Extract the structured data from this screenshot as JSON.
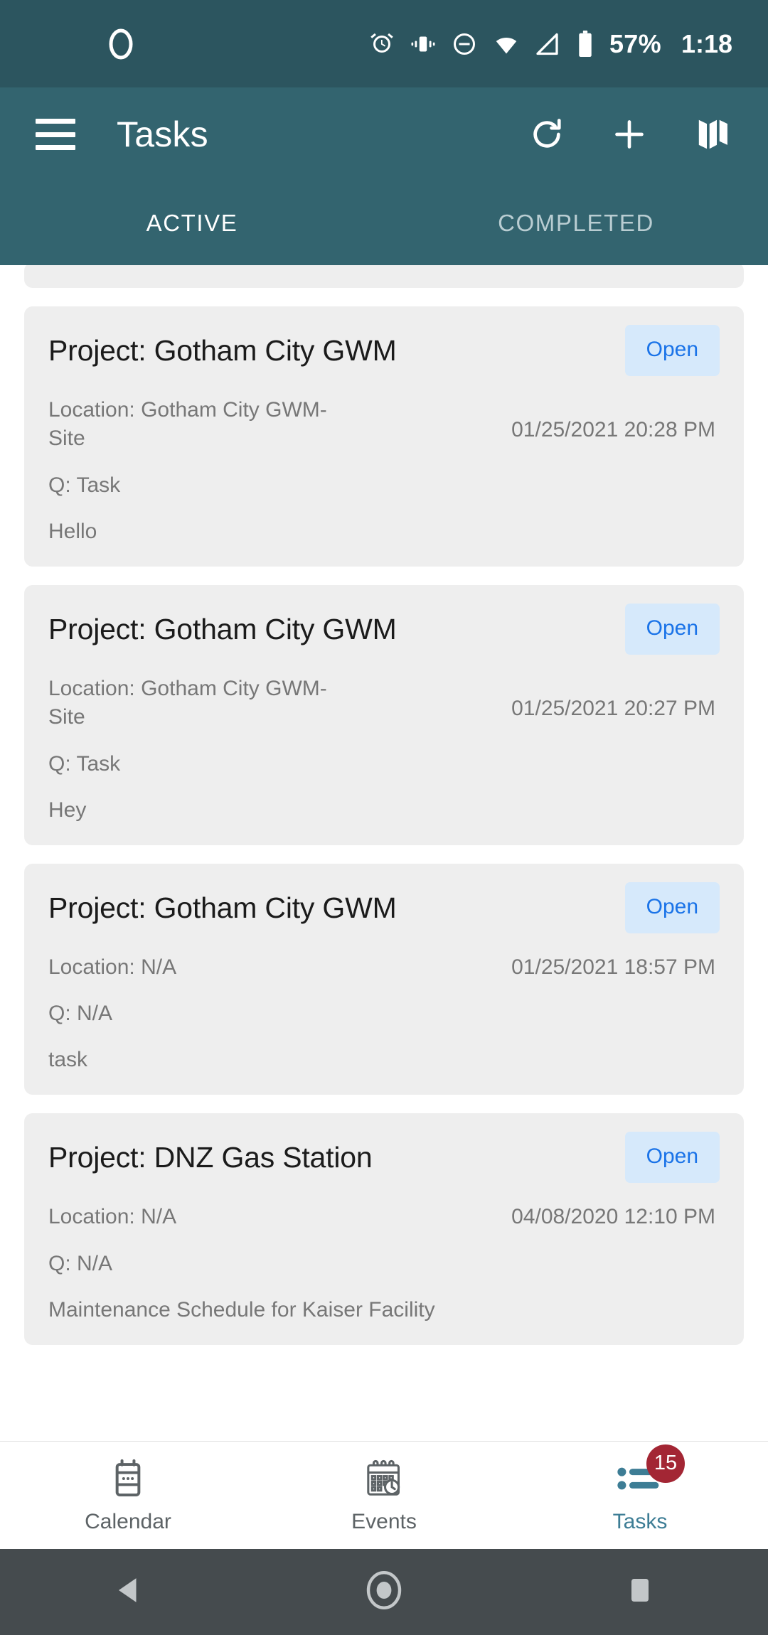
{
  "status_bar": {
    "app_indicator_icon": "app-oval-icon",
    "icons": [
      "alarm-icon",
      "vibrate-icon",
      "do-not-disturb-icon",
      "wifi-icon",
      "cell-signal-icon",
      "battery-icon"
    ],
    "battery_percent": "57%",
    "time": "1:18",
    "background_color": "#2c555f"
  },
  "appbar": {
    "menu_icon": "hamburger-menu-icon",
    "title": "Tasks",
    "actions": [
      {
        "name": "refresh-icon",
        "label": "Refresh"
      },
      {
        "name": "add-icon",
        "label": "Add"
      },
      {
        "name": "map-icon",
        "label": "Map"
      }
    ],
    "background_color": "#33646f"
  },
  "tabs": [
    {
      "label": "ACTIVE",
      "selected": true
    },
    {
      "label": "COMPLETED",
      "selected": false
    }
  ],
  "list": {
    "open_label": "Open",
    "cards": [
      {
        "title": "Project: Gotham City GWM",
        "location": "Location: Gotham City GWM-Site",
        "date": "01/25/2021 20:28 PM",
        "q": "Q: Task",
        "description": "Hello"
      },
      {
        "title": "Project: Gotham City GWM",
        "location": "Location: Gotham City GWM-Site",
        "date": "01/25/2021 20:27 PM",
        "q": "Q: Task",
        "description": "Hey"
      },
      {
        "title": "Project: Gotham City GWM",
        "location": "Location: N/A",
        "date": "01/25/2021 18:57 PM",
        "q": "Q: N/A",
        "description": "task"
      },
      {
        "title": "Project: DNZ Gas Station",
        "location": "Location: N/A",
        "date": "04/08/2020 12:10 PM",
        "q": "Q: N/A",
        "description": "Maintenance Schedule for Kaiser Facility"
      }
    ]
  },
  "bottom_nav": {
    "items": [
      {
        "label": "Calendar",
        "icon": "calendar-device-icon",
        "selected": false,
        "badge": null
      },
      {
        "label": "Events",
        "icon": "event-calendar-clock-icon",
        "selected": false,
        "badge": null
      },
      {
        "label": "Tasks",
        "icon": "task-list-icon",
        "selected": true,
        "badge": "15"
      }
    ],
    "active_color": "#3d7d95",
    "inactive_color": "#5d6366",
    "badge_color": "#a32634"
  },
  "android_nav": {
    "buttons": [
      {
        "name": "back-button",
        "icon": "back-triangle-icon"
      },
      {
        "name": "home-button",
        "icon": "home-circle-icon"
      },
      {
        "name": "recents-button",
        "icon": "recents-square-icon"
      }
    ],
    "background_color": "#454b4e"
  }
}
